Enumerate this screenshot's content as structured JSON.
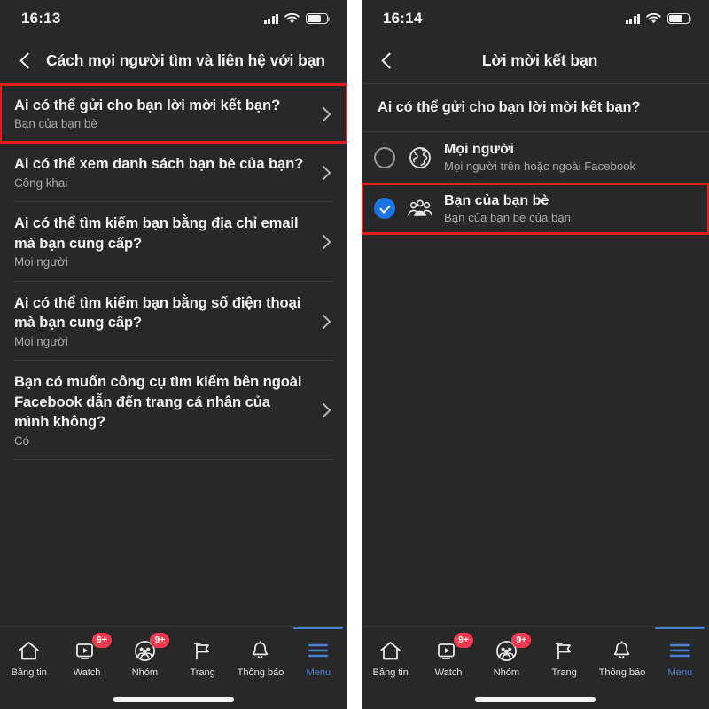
{
  "left_phone": {
    "status_bar": {
      "time": "16:13",
      "signal_icon": "cellular-signal-icon",
      "wifi_icon": "wifi-icon",
      "battery_icon": "battery-icon"
    },
    "header": {
      "back_icon": "back-chevron-icon",
      "title": "Cách mọi người tìm và liên hệ với bạn"
    },
    "settings_rows": [
      {
        "title": "Ai có thể gửi cho bạn lời mời kết bạn?",
        "value": "Bạn của bạn bè",
        "highlighted": true
      },
      {
        "title": "Ai có thể xem danh sách bạn bè của bạn?",
        "value": "Công khai",
        "highlighted": false
      },
      {
        "title": "Ai có thể tìm kiếm bạn bằng địa chỉ email mà bạn cung cấp?",
        "value": "Mọi người",
        "highlighted": false
      },
      {
        "title": "Ai có thể tìm kiếm bạn bằng số điện thoại mà bạn cung cấp?",
        "value": "Mọi người",
        "highlighted": false
      },
      {
        "title": "Bạn có muốn công cụ tìm kiếm bên ngoài Facebook dẫn đến trang cá nhân của mình không?",
        "value": "Có",
        "highlighted": false
      }
    ]
  },
  "right_phone": {
    "status_bar": {
      "time": "16:14",
      "signal_icon": "cellular-signal-icon",
      "wifi_icon": "wifi-icon",
      "battery_icon": "battery-icon"
    },
    "header": {
      "back_icon": "back-chevron-icon",
      "title": "Lời mời kết bạn"
    },
    "section_question": "Ai có thể gửi cho bạn lời mời kết bạn?",
    "options": [
      {
        "title": "Mọi người",
        "subtitle": "Mọi người trên hoặc ngoài Facebook",
        "icon": "globe-icon",
        "selected": false,
        "highlighted": false
      },
      {
        "title": "Bạn của bạn bè",
        "subtitle": "Bạn của bạn bè của bạn",
        "icon": "friends-group-icon",
        "selected": true,
        "highlighted": true
      }
    ]
  },
  "tabbar": {
    "items": [
      {
        "label": "Bảng tin",
        "icon": "home-icon",
        "badge": "",
        "active": false
      },
      {
        "label": "Watch",
        "icon": "video-icon",
        "badge": "9+",
        "active": false
      },
      {
        "label": "Nhóm",
        "icon": "groups-icon",
        "badge": "9+",
        "active": false
      },
      {
        "label": "Trang",
        "icon": "flag-icon",
        "badge": "",
        "active": false
      },
      {
        "label": "Thông báo",
        "icon": "bell-icon",
        "badge": "",
        "active": false
      },
      {
        "label": "Menu",
        "icon": "hamburger-menu-icon",
        "badge": "",
        "active": true
      }
    ]
  },
  "colors": {
    "background": "#282828",
    "accent_blue": "#1b74e4",
    "tab_active_blue": "#4a7fd4",
    "badge_red": "#f23b50",
    "highlight_red": "#e81c1c",
    "text_primary": "#f2f2f2",
    "text_secondary": "#a8a8a8"
  }
}
